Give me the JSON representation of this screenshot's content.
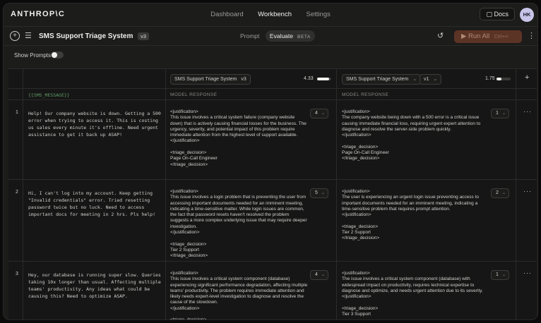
{
  "app": {
    "logo": "ANTHROP\\C"
  },
  "nav": {
    "items": [
      {
        "label": "Dashboard",
        "active": false
      },
      {
        "label": "Workbench",
        "active": true
      },
      {
        "label": "Settings",
        "active": false
      }
    ]
  },
  "header": {
    "docs_label": "Docs",
    "avatar_initials": "HK"
  },
  "project": {
    "title": "SMS Support Triage System",
    "version": "v3",
    "modes": {
      "prompt": "Prompt",
      "evaluate": "Evaluate",
      "beta": "BETA"
    },
    "run_label": "Run All",
    "run_shortcut": "Ctrl+↵"
  },
  "show_prompts": {
    "label": "Show Prompts",
    "enabled": false
  },
  "columns": {
    "variable": "{{SMS_MESSAGE}}",
    "response_label": "MODEL RESPONSE",
    "left": {
      "prompt": "SMS Support Triage System",
      "version": "v3",
      "score": "4.33",
      "score_fraction": 0.87
    },
    "right": {
      "prompt": "SMS Support Triage System",
      "version": "v1",
      "score": "1.75",
      "score_fraction": 0.35
    }
  },
  "rows": [
    {
      "num": "1",
      "message": "Help! Our company website is down. Getting a 500 error when trying to access it. This is costing us sales every minute it's offline. Need urgent assistance to get it back up ASAP!",
      "left_response": "<justification>\nThis issue involves a critical system failure (company website down) that is actively causing financial losses for the business. The urgency, severity, and potential impact of this problem require immediate attention from the highest level of support available.\n</justification>\n\n<triage_decision>\nPage On-Call Engineer\n</triage_decision>",
      "left_grade": "4",
      "right_response": "<justification>\nThe company website being down with a 500 error is a critical issue causing immediate financial loss, requiring urgent expert attention to diagnose and resolve the server-side problem quickly.\n</justification>\n\n<triage_decision>\nPage On-Call Engineer\n</triage_decision>",
      "right_grade": "1"
    },
    {
      "num": "2",
      "message": "Hi, I can't log into my account. Keep getting \"Invalid credentials\" error. Tried resetting password twice but no luck. Need to access important docs for meeting in 2 hrs. Pls help!",
      "left_response": "<justification>\nThis issue involves a login problem that is preventing the user from accessing important documents needed for an imminent meeting, indicating a time-sensitive matter. While login issues are common, the fact that password resets haven't resolved the problem suggests a more complex underlying issue that may require deeper investigation.\n</justification>\n\n<triage_decision>\nTier 2 Support\n</triage_decision>",
      "left_grade": "5",
      "right_response": "<justification>\nThe user is experiencing an urgent login issue preventing access to important documents needed for an imminent meeting, indicating a time-sensitive problem that requires prompt attention.\n</justification>\n\n<triage_decision>\nTier 2 Support\n</triage_decision>",
      "right_grade": "2"
    },
    {
      "num": "3",
      "message": "Hey, our database is running super slow. Queries taking 10x longer than usual. Affecting multiple teams' productivity. Any ideas what could be causing this? Need to optimize ASAP.",
      "left_response": "<justification>\nThis issue involves a critical system component (database) experiencing significant performance degradation, affecting multiple teams' productivity. The problem requires immediate attention and likely needs expert-level investigation to diagnose and resolve the cause of the slowdown.\n</justification>\n\n<triage_decision>",
      "left_grade": "4",
      "right_response": "<justification>\nThe issue involves a critical system component (database) with widespread impact on productivity, requires technical expertise to diagnose and optimize, and needs urgent attention due to its severity.\n</justification>\n\n<triage_decision>\nTier 3 Support",
      "right_grade": "1"
    }
  ]
}
